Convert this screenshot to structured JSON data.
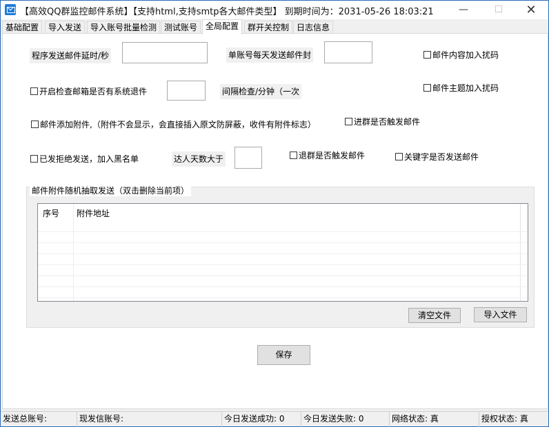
{
  "window": {
    "title": "【高效QQ群监控邮件系统】【支持html,支持smtp各大邮件类型】   到期时间为：2031-05-26 18:03:21",
    "minimize_icon": "minimize-icon",
    "maximize_icon": "maximize-icon",
    "close_icon": "close-icon",
    "minimize_glyph": "—",
    "maximize_glyph": "☐",
    "close_glyph": "✕"
  },
  "tabs": [
    {
      "label": "基础配置"
    },
    {
      "label": "导入发送"
    },
    {
      "label": "导入账号批量检测"
    },
    {
      "label": "测试账号"
    },
    {
      "label": "全局配置"
    },
    {
      "label": "群开关控制"
    },
    {
      "label": "日志信息"
    }
  ],
  "active_tab": "全局配置",
  "form": {
    "send_delay_label": "程序发送邮件延时/秒",
    "send_delay_value": "",
    "daily_limit_label": "单账号每天发送邮件封",
    "daily_limit_value": "",
    "content_noise_label": "邮件内容加入扰码",
    "check_bounce_label": "开启检查邮箱是否有系统退件",
    "check_bounce_value": "",
    "interval_label": "间隔检查/分钟（一次",
    "subject_noise_label": "邮件主题加入扰码",
    "attach_label": "邮件添加附件,（附件不会显示，会直接插入原文防屏蔽，收件有附件标志）",
    "join_trigger_label": "进群是否触发邮件",
    "blacklist_label": "已发拒绝发送，加入黑名单",
    "expert_days_label": "达人天数大于",
    "expert_days_value": "",
    "leave_trigger_label": "退群是否触发邮件",
    "keyword_label": "关键字是否发送邮件"
  },
  "attachments": {
    "group_title": "邮件附件随机抽取发送（双击删除当前项）",
    "columns": [
      "序号",
      "附件地址"
    ],
    "rows": [],
    "clear_button": "清空文件",
    "import_button": "导入文件"
  },
  "save_button": "保存",
  "statusbar": {
    "total_accounts": "发送总账号:",
    "current_account": "现发信账号:",
    "today_success": "今日发送成功: 0",
    "today_fail": "今日发送失败: 0",
    "network_status": "网络状态: 真",
    "license_status": "授权状态: 真"
  }
}
